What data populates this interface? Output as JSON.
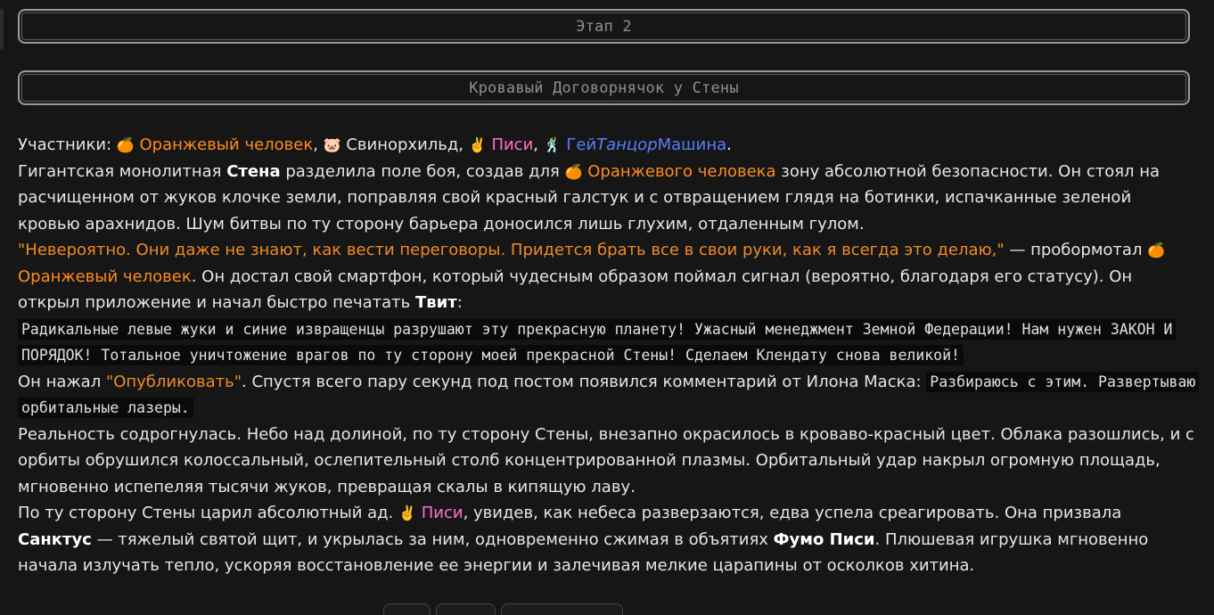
{
  "stage": {
    "title": "Этап 2"
  },
  "chapter": {
    "title": "Кровавый Договорнячок у Стены"
  },
  "participants": {
    "label": "Участники:",
    "list": [
      {
        "emoji": "🍊",
        "name": "Оранжевый человек"
      },
      {
        "emoji": "🐷",
        "name": "Свинорхильд"
      },
      {
        "emoji": "✌️",
        "name": "Писи"
      },
      {
        "emoji": "🕺",
        "name_a": "Гей",
        "name_b": "Танцор",
        "name_c": "Машина"
      }
    ]
  },
  "story": {
    "p1_a": "Гигантская монолитная ",
    "p1_wall": "Стена",
    "p1_b": " разделила поле боя, создав для ",
    "p1_emoji": "🍊",
    "p1_orange": "Оранжевого человека",
    "p1_c": " зону абсолютной безопасности. Он стоял на расчищенном от жуков клочке земли, поправляя свой красный галстук и с отвращением глядя на ботинки, испачканные зеленой кровью арахнидов. Шум битвы по ту сторону барьера доносился лишь глухим, отдаленным гулом.",
    "p2_quote": "\"Невероятно. Они даже не знают, как вести переговоры. Придется брать все в свои руки, как я всегда это делаю,\"",
    "p2_a": " — пробормотал ",
    "p2_emoji": "🍊",
    "p2_orange": "Оранжевый человек",
    "p2_b": ". Он достал свой смартфон, который чудесным образом поймал сигнал (вероятно, благодаря его статусу). Он открыл приложение и начал быстро печатать ",
    "p2_tweet": "Твит",
    "p2_c": ":",
    "tweet": "Радикальные левые жуки и синие извращенцы разрушают эту прекрасную планету! Ужасный менеджмент Земной Федерации! Нам нужен ЗАКОН И ПОРЯДОК! Тотальное уничтожение врагов по ту сторону моей прекрасной Стены! Сделаем Клендату снова великой!",
    "p3_a": "Он нажал ",
    "p3_publish": "\"Опубликовать\"",
    "p3_b": ". Спустя всего пару секунд под постом появился комментарий от Илона Маска: ",
    "musk_reply": "Разбираюсь с этим. Развертываю орбитальные лазеры.",
    "p4": "Реальность содрогнулась. Небо над долиной, по ту сторону Стены, внезапно окрасилось в кроваво-красный цвет. Облака разошлись, и с орбиты обрушился колоссальный, ослепительный столб концентрированной плазмы. Орбитальный удар накрыл огромную площадь, мгновенно испепеляя тысячи жуков, превращая скалы в кипящую лаву.",
    "p5_a": "По ту сторону Стены царил абсолютный ад. ",
    "p5_emoji": "✌️",
    "p5_pisi": "Писи",
    "p5_b": ", увидев, как небеса разверзаются, едва успела среагировать. Она призвала ",
    "p5_sanctus": "Санктус",
    "p5_c": " — тяжелый святой щит, и укрылась за ним, одновременно сжимая в объятиях ",
    "p5_fumo": "Фумо Писи",
    "p5_d": ". Плюшевая игрушка мгновенно начала излучать тепло, ускоряя восстановление ее энергии и залечивая мелкие царапины от осколков хитина."
  },
  "colors": {
    "orange_character": "#ff8c1a",
    "pink_character": "#ff6fcf",
    "blue_character": "#5a7cff",
    "background": "#161616"
  }
}
